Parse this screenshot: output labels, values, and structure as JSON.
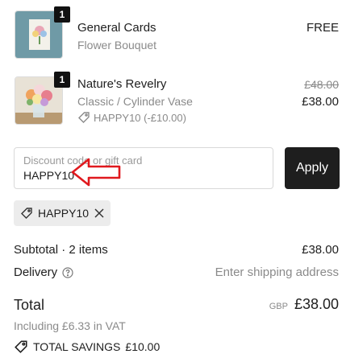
{
  "items": [
    {
      "qty": "1",
      "title": "General Cards",
      "variant": "Flower Bouquet",
      "price": "FREE"
    },
    {
      "qty": "1",
      "title": "Nature's Revelry",
      "variant": "Classic / Cylinder Vase",
      "discount_tag": "HAPPY10 (-£10.00)",
      "original_price": "£48.00",
      "price": "£38.00"
    }
  ],
  "discount": {
    "placeholder": "Discount code or gift card",
    "value": "HAPPY10",
    "apply_label": "Apply",
    "applied_code": "HAPPY10"
  },
  "summary": {
    "subtotal_label": "Subtotal · 2 items",
    "subtotal_value": "£38.00",
    "delivery_label": "Delivery",
    "delivery_value": "Enter shipping address",
    "total_label": "Total",
    "currency": "GBP",
    "total_value": "£38.00",
    "vat_note": "Including £6.33 in VAT",
    "savings_label": "TOTAL SAVINGS",
    "savings_value": "£10.00"
  },
  "colors": {
    "annotation_arrow": "#e0191e",
    "button_bg": "#1e1e1e"
  }
}
